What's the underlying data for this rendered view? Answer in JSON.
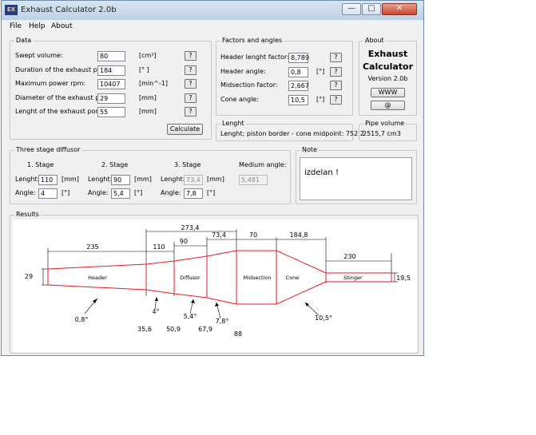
{
  "window": {
    "title": "Exhaust Calculator 2.0b",
    "icon": "app-icon"
  },
  "titlebar_buttons": {
    "minimize": "—",
    "maximize": "□",
    "close": "✕"
  },
  "menu": [
    "File",
    "Help",
    "About"
  ],
  "data_group": {
    "title": "Data",
    "rows": [
      {
        "label": "Swept volume:",
        "value": "80",
        "unit": "[cm³]",
        "help": "?"
      },
      {
        "label": "Duration of the exhaust port:",
        "value": "184",
        "unit": "[° ]",
        "help": "?"
      },
      {
        "label": "Maximum power rpm:",
        "value": "10407",
        "unit": "[min^-1]",
        "help": "?"
      },
      {
        "label": "Diameter of the exhaust port:",
        "value": "29",
        "unit": "[mm]",
        "help": "?"
      },
      {
        "label": "Lenght of the exhaust port:",
        "value": "55",
        "unit": "[mm]",
        "help": "?"
      }
    ],
    "calculate_label": "Calculate"
  },
  "factors_group": {
    "title": "Factors and angles",
    "rows": [
      {
        "label": "Header lenght factor:",
        "value": "8,789",
        "unit": "",
        "help": "?"
      },
      {
        "label": "Header angle:",
        "value": "0,8",
        "unit": "[°]",
        "help": "?"
      },
      {
        "label": "Midsection factor:",
        "value": "2,667",
        "unit": "",
        "help": "?"
      },
      {
        "label": "Cone angle:",
        "value": "10,5",
        "unit": "[°]",
        "help": "?"
      }
    ]
  },
  "about_group": {
    "title": "About",
    "name_line1": "Exhaust",
    "name_line2": "Calculator",
    "version": "Version 2.0b",
    "www_label": "WWW",
    "email_label": "@"
  },
  "lenght_group": {
    "title": "Lenght",
    "text": "Lenght; piston border - cone midpoint:  752,2"
  },
  "pipe_group": {
    "title": "Pipe volume",
    "value": "2515,7 cm3"
  },
  "diffusor_group": {
    "title": "Three stage diffusor",
    "stages": [
      {
        "title": "1. Stage",
        "lenght_label": "Lenght:",
        "lenght": "110",
        "lenght_unit": "[mm]",
        "angle_label": "Angle:",
        "angle": "4",
        "angle_unit": "[°]"
      },
      {
        "title": "2. Stage",
        "lenght_label": "Lenght:",
        "lenght": "90",
        "lenght_unit": "[mm]",
        "angle_label": "Angle:",
        "angle": "5,4",
        "angle_unit": "[°]"
      },
      {
        "title": "3. Stage",
        "lenght_label": "Lenght:",
        "lenght": "73,4",
        "lenght_unit": "[mm]",
        "angle_label": "Angle:",
        "angle": "7,8",
        "angle_unit": "[°]"
      }
    ],
    "medium_title": "Medium angle:",
    "medium_value": "5,481"
  },
  "note_group": {
    "title": "Note",
    "text": "izdelan !"
  },
  "results_group": {
    "title": "Results",
    "dims": {
      "d235": "235",
      "d110": "110",
      "d273": "273,4",
      "d90": "90",
      "d73": "73,4",
      "d70": "70",
      "d184": "184,8",
      "d230": "230",
      "d29": "29",
      "d195": "19,5"
    },
    "sections": {
      "header": "Header",
      "diffusor": "Diffusor",
      "midsection": "Midsection",
      "cone": "Cone",
      "stinger": "Stinger"
    },
    "diameters": {
      "a": "35,6",
      "b": "50,9",
      "c": "67,9",
      "d": "88"
    },
    "angles": {
      "header": "0,8°",
      "s1": "4°",
      "s2": "5,4°",
      "s3": "7,8°",
      "cone": "10,5°"
    }
  },
  "colors": {
    "pipe_outline": "#e8191f",
    "dim_line": "#000000",
    "window_bg": "#f0f0f0"
  }
}
